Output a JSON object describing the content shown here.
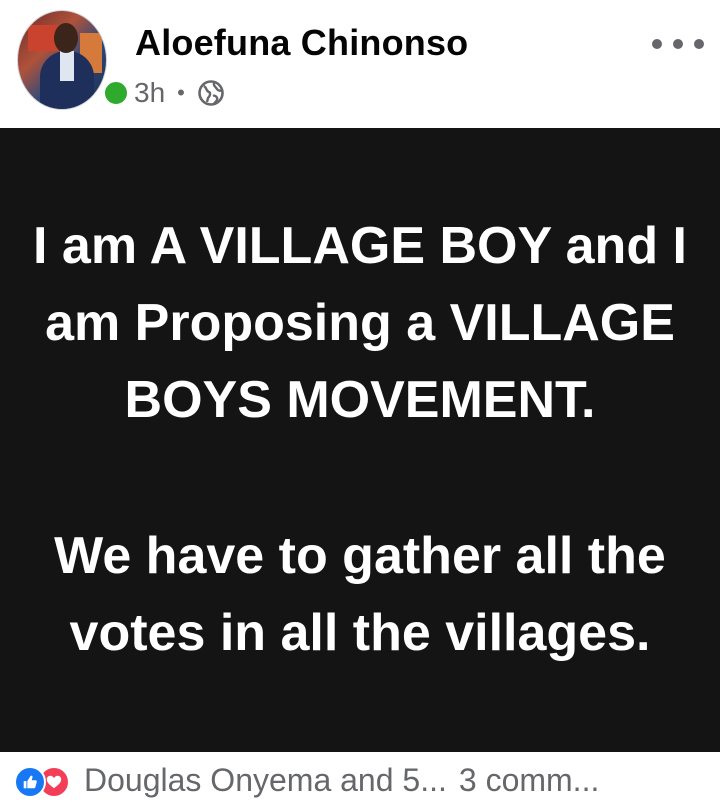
{
  "post": {
    "author": "Aloefuna Chinonso",
    "time": "3h",
    "separator": "•",
    "privacy_icon": "globe-icon",
    "more_icon": "more-options-icon",
    "presence_color": "#2eab2e",
    "body": {
      "paragraph_1": "I am A VILLAGE BOY and I am Proposing a VILLAGE BOYS MOVEMENT.",
      "paragraph_2": "We have to gather all the votes in all the villages.",
      "background_color": "#141414",
      "text_color": "#ffffff"
    },
    "footer": {
      "reaction_icons": [
        "like-icon",
        "love-icon"
      ],
      "reactions_summary": "Douglas Onyema and 5...",
      "comments_summary": "3 comm..."
    }
  }
}
